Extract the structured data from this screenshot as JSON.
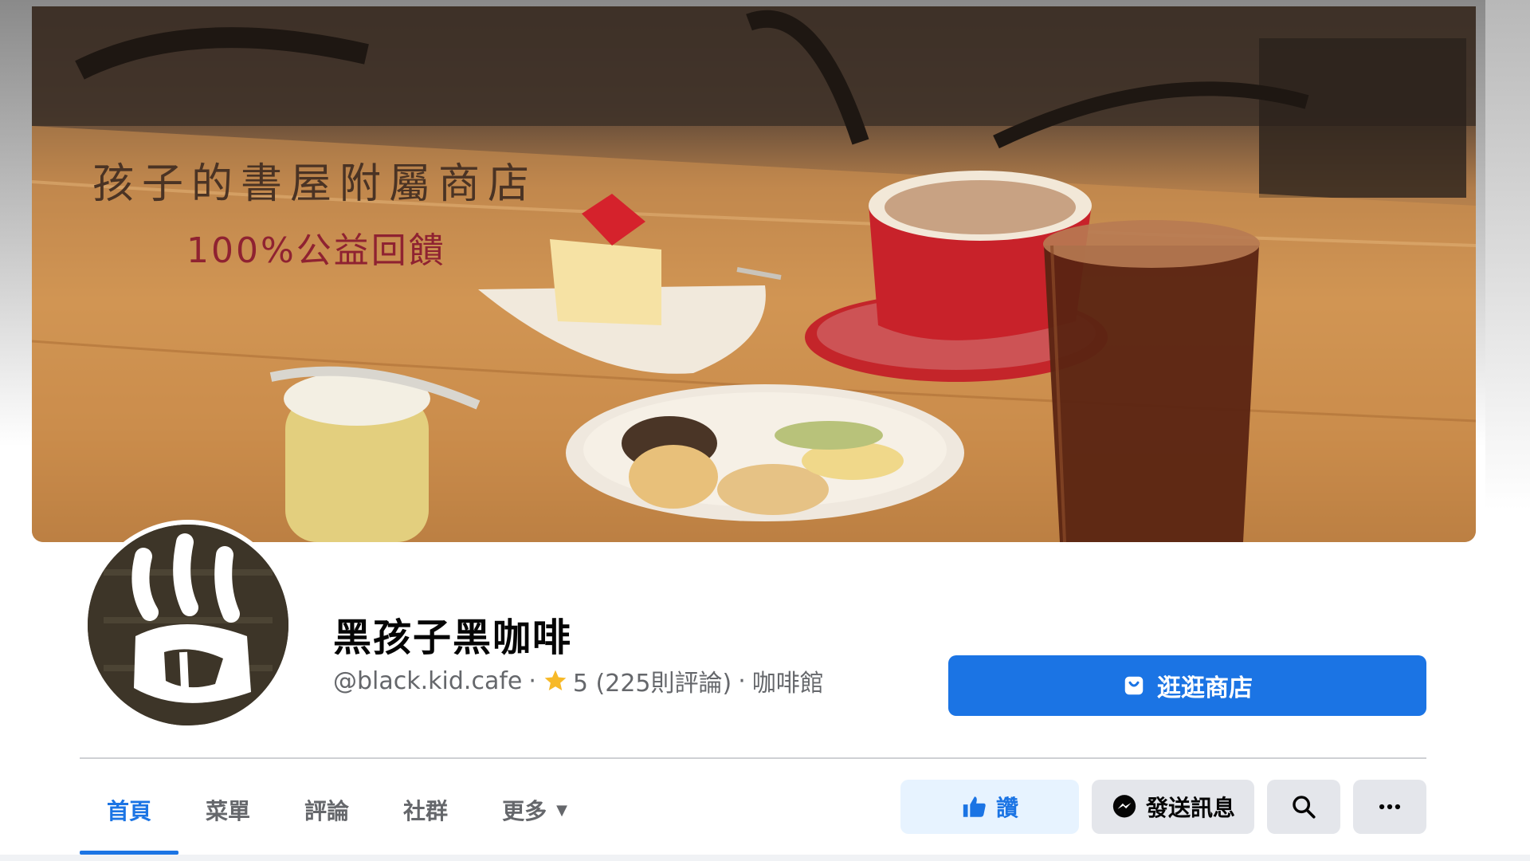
{
  "cover": {
    "title": "孩子的書屋附屬商店",
    "subtitle": "100%公益回饋"
  },
  "profile": {
    "name": "黑孩子黑咖啡",
    "handle": "@black.kid.cafe",
    "rating": "5 (225則評論)",
    "category": "咖啡館",
    "meta_separator": "·"
  },
  "shop_button": {
    "label": "逛逛商店",
    "icon": "shop-bag-icon"
  },
  "tabs": [
    {
      "label": "首頁",
      "active": true
    },
    {
      "label": "菜單"
    },
    {
      "label": "評論"
    },
    {
      "label": "社群"
    },
    {
      "label": "更多",
      "icon": "caret-down-icon"
    }
  ],
  "actions": {
    "like_label": "讚",
    "message_label": "發送訊息"
  },
  "colors": {
    "accent": "#1b74e4",
    "button_grey": "#e4e6eb",
    "like_bg": "#e7f3ff",
    "star": "#f7b928"
  }
}
